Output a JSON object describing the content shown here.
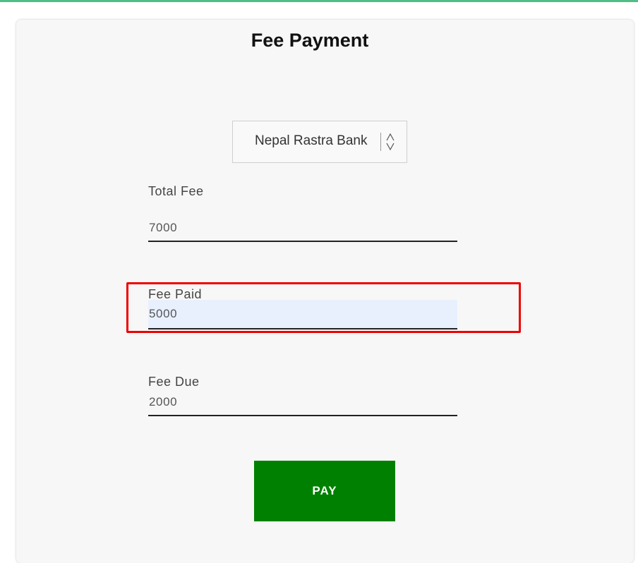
{
  "form": {
    "title": "Fee Payment",
    "bank_select": {
      "selected": "Nepal Rastra Bank",
      "icon": "updown-chevron-icon"
    },
    "total_fee": {
      "label": "Total Fee",
      "value": "7000"
    },
    "fee_paid": {
      "label": "Fee Paid",
      "value": "5000"
    },
    "fee_due": {
      "label": "Fee Due",
      "value": "2000"
    },
    "pay_button": {
      "label": "PAY"
    }
  },
  "colors": {
    "accent_bar": "#4fbf85",
    "pay_button": "#008000",
    "highlight": "#ee0000",
    "autofill": "#e8f0fe"
  }
}
